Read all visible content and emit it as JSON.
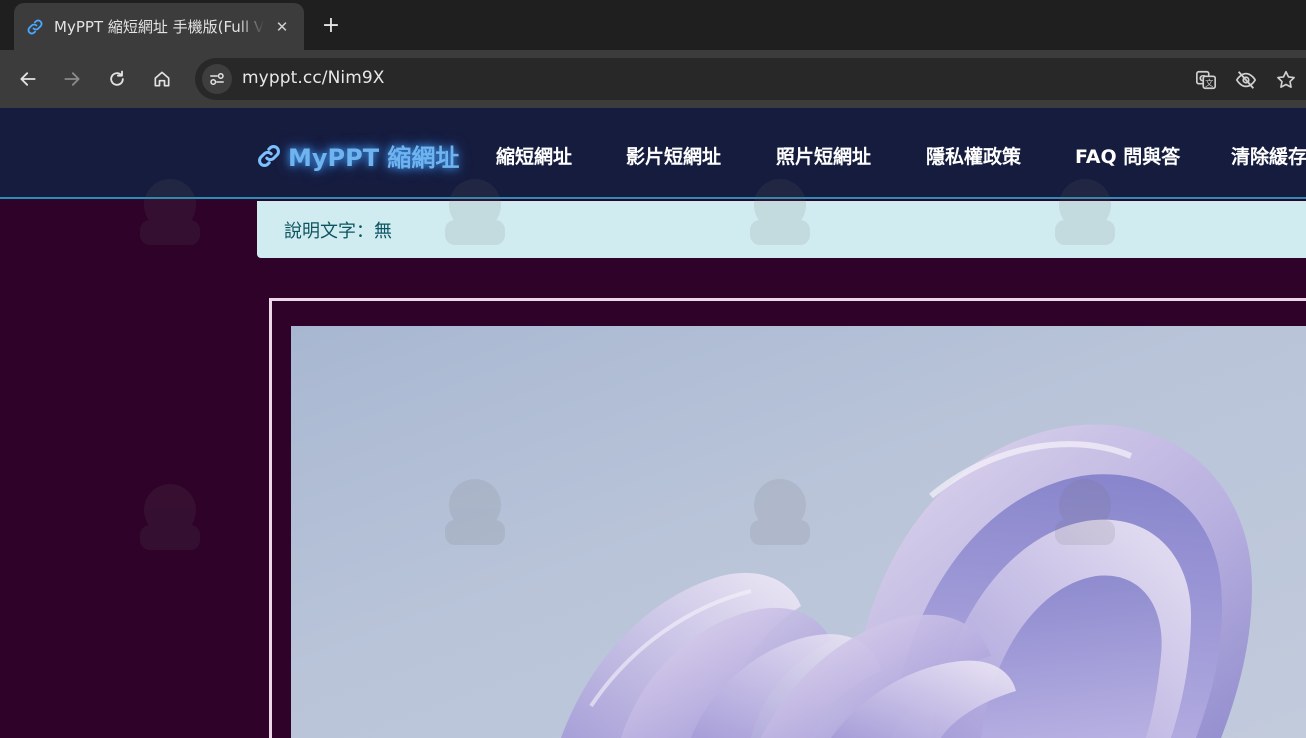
{
  "browser": {
    "tab_title": "MyPPT 縮短網址 手機版(Full Version)",
    "tab_favicon": "link-icon",
    "url": "myppt.cc/Nim9X"
  },
  "navbar": {
    "brand": "MyPPT 縮網址",
    "links": [
      "縮短網址",
      "影片短網址",
      "照片短網址",
      "隱私權政策",
      "FAQ 問與答",
      "清除緩存"
    ]
  },
  "alert": {
    "text": "說明文字：無"
  },
  "colors": {
    "page_bg": "#2e0229",
    "navbar_bg": "#161c3e",
    "brand_glow": "#6fb4ee",
    "alert_bg": "#d1ecf1",
    "alert_text": "#0c5460"
  }
}
